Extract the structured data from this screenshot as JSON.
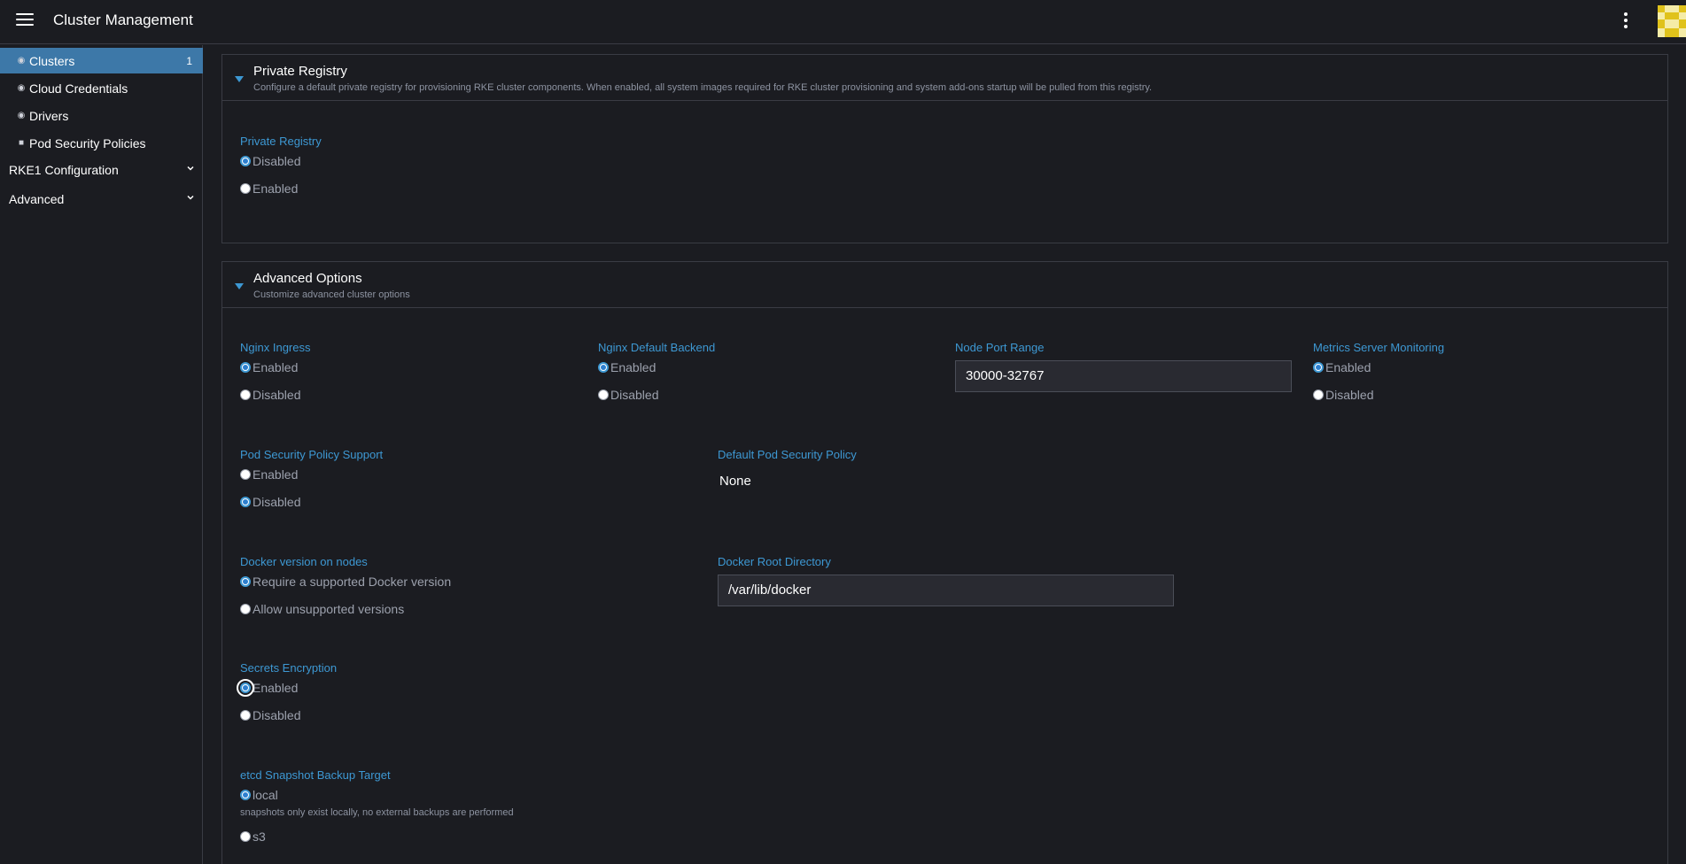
{
  "header": {
    "title": "Cluster Management"
  },
  "sidebar": {
    "items": [
      {
        "label": "Clusters",
        "count": "1"
      },
      {
        "label": "Cloud Credentials"
      },
      {
        "label": "Drivers"
      },
      {
        "label": "Pod Security Policies"
      }
    ],
    "groups": [
      {
        "label": "RKE1 Configuration"
      },
      {
        "label": "Advanced"
      }
    ]
  },
  "private_registry_panel": {
    "title": "Private Registry",
    "description": "Configure a default private registry for provisioning RKE cluster components. When enabled, all system images required for RKE cluster provisioning and system add-ons startup will be pulled from this registry.",
    "field_label": "Private Registry",
    "options": [
      "Disabled",
      "Enabled"
    ],
    "selected": "Disabled"
  },
  "advanced_panel": {
    "title": "Advanced Options",
    "description": "Customize advanced cluster options",
    "nginx_ingress": {
      "label": "Nginx Ingress",
      "options": [
        "Enabled",
        "Disabled"
      ],
      "selected": "Enabled"
    },
    "nginx_default_backend": {
      "label": "Nginx Default Backend",
      "options": [
        "Enabled",
        "Disabled"
      ],
      "selected": "Enabled"
    },
    "node_port_range": {
      "label": "Node Port Range",
      "value": "30000-32767"
    },
    "metrics_server": {
      "label": "Metrics Server Monitoring",
      "options": [
        "Enabled",
        "Disabled"
      ],
      "selected": "Enabled"
    },
    "psp_support": {
      "label": "Pod Security Policy Support",
      "options": [
        "Enabled",
        "Disabled"
      ],
      "selected": "Disabled"
    },
    "default_psp": {
      "label": "Default Pod Security Policy",
      "value": "None"
    },
    "docker_version": {
      "label": "Docker version on nodes",
      "options": [
        "Require a supported Docker version",
        "Allow unsupported versions"
      ],
      "selected": "Require a supported Docker version"
    },
    "docker_root": {
      "label": "Docker Root Directory",
      "value": "/var/lib/docker"
    },
    "secrets_encryption": {
      "label": "Secrets Encryption",
      "options": [
        "Enabled",
        "Disabled"
      ],
      "selected": "Enabled"
    },
    "etcd_backup": {
      "label": "etcd Snapshot Backup Target",
      "options": [
        "local",
        "s3"
      ],
      "selected": "local",
      "local_hint": "snapshots only exist locally, no external backups are performed"
    }
  },
  "colors": {
    "accent": "#3d98d3",
    "active_nav": "#3d78a8",
    "background": "#1b1c21"
  }
}
